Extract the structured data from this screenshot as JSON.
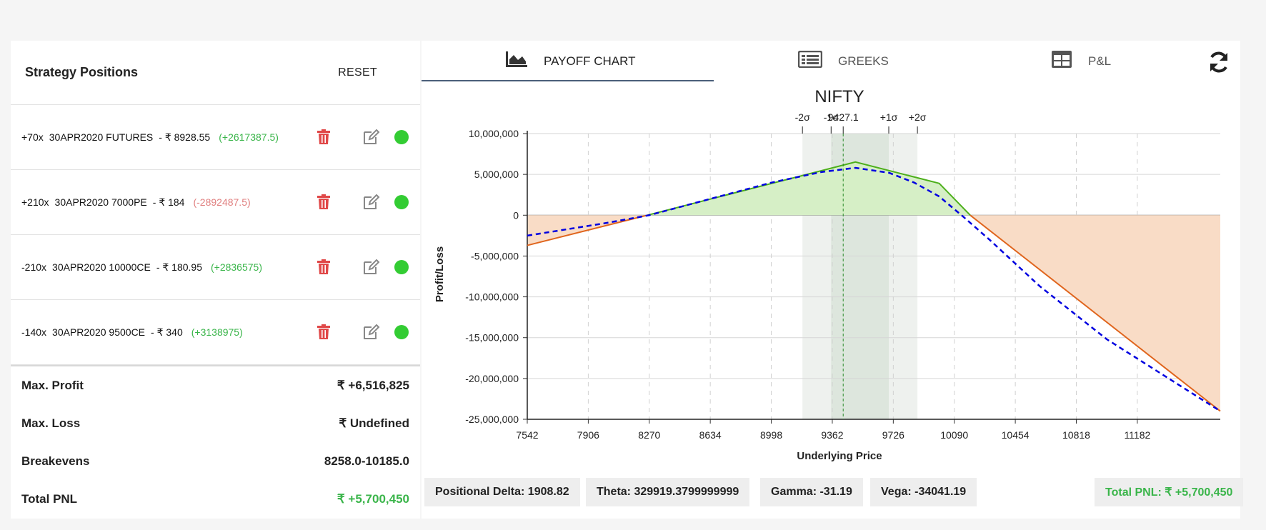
{
  "left": {
    "title": "Strategy Positions",
    "reset_label": "RESET",
    "positions": [
      {
        "qty": "+70x",
        "symbol": "30APR2020  FUTURES",
        "price": "- ₹ 8928.55",
        "pnl": "(+2617387.5)",
        "pnl_sign": "pos"
      },
      {
        "qty": "+210x",
        "symbol": "30APR2020  7000PE",
        "price": "- ₹ 184",
        "pnl": "(-2892487.5)",
        "pnl_sign": "neg"
      },
      {
        "qty": "-210x",
        "symbol": "30APR2020  10000CE",
        "price": "- ₹ 180.95",
        "pnl": "(+2836575)",
        "pnl_sign": "pos"
      },
      {
        "qty": "-140x",
        "symbol": "30APR2020  9500CE",
        "price": "- ₹ 340",
        "pnl": "(+3138975)",
        "pnl_sign": "pos"
      }
    ],
    "summary": [
      {
        "label": "Max. Profit",
        "value": "₹ +6,516,825"
      },
      {
        "label": "Max. Loss",
        "value": "₹ Undefined"
      },
      {
        "label": "Breakevens",
        "value": "8258.0-10185.0"
      },
      {
        "label": "Total PNL",
        "value": "₹ +5,700,450"
      }
    ]
  },
  "tabs": [
    {
      "label": "PAYOFF CHART",
      "icon": "area-chart-icon"
    },
    {
      "label": "GREEKS",
      "icon": "list-icon"
    },
    {
      "label": "P&L",
      "icon": "table-icon"
    }
  ],
  "stats": {
    "delta": "Positional Delta: 1908.82",
    "theta": "Theta: 329919.3799999999",
    "gamma": "Gamma: -31.19",
    "vega": "Vega: -34041.19",
    "total_pnl": "Total PNL: ₹ +5,700,450"
  },
  "colors": {
    "profit_fill": "#d6efc6",
    "loss_fill": "#f9dcc6",
    "expiry_line_profit": "#4caf1a",
    "expiry_line_loss": "#e0651d",
    "today_line": "#0000e0",
    "sigma_band_outer": "#eef1ee",
    "sigma_band_inner": "#dde6dd",
    "green_text": "#3ab54a",
    "red_text": "#e07f7f",
    "delete_icon": "#e04848"
  },
  "chart_data": {
    "type": "line",
    "title": "NIFTY",
    "xlabel": "Underlying Price",
    "ylabel": "Profit/Loss",
    "x_ticks": [
      7542,
      7906,
      8270,
      8634,
      8998,
      9362,
      9726,
      10090,
      10454,
      10818,
      11182
    ],
    "y_ticks": [
      10000000,
      5000000,
      0,
      -5000000,
      -10000000,
      -15000000,
      -20000000,
      -25000000
    ],
    "y_tick_labels": [
      "10,000,000",
      "5,000,000",
      "0",
      "-5,000,000",
      "-10,000,000",
      "-15,000,000",
      "-20,000,000",
      "-25,000,000"
    ],
    "xlim": [
      7542,
      11677
    ],
    "ylim": [
      -25000000,
      10000000
    ],
    "spot": 9427.1,
    "spot_label": "9427.1",
    "sigma_markers": [
      {
        "label": "-2σ",
        "x": 9184
      },
      {
        "label": "-1σ",
        "x": 9355
      },
      {
        "label": "+1σ",
        "x": 9699
      },
      {
        "label": "+2σ",
        "x": 9870
      }
    ],
    "series": [
      {
        "key": "expiry",
        "x": [
          7542,
          8258,
          9500,
          10000,
          10185,
          11677
        ],
        "values": [
          -3700000,
          0,
          6516825,
          3900000,
          0,
          -24000000
        ]
      },
      {
        "key": "today",
        "x": [
          7542,
          8000,
          8270,
          8634,
          9000,
          9300,
          9500,
          9700,
          9850,
          10000,
          10150,
          10300,
          10600,
          11000,
          11677
        ],
        "values": [
          -2500000,
          -1000000,
          0,
          2000000,
          4000000,
          5300000,
          5800000,
          5200000,
          4000000,
          2300000,
          -300000,
          -3000000,
          -8700000,
          -15200000,
          -24000000
        ]
      }
    ]
  }
}
